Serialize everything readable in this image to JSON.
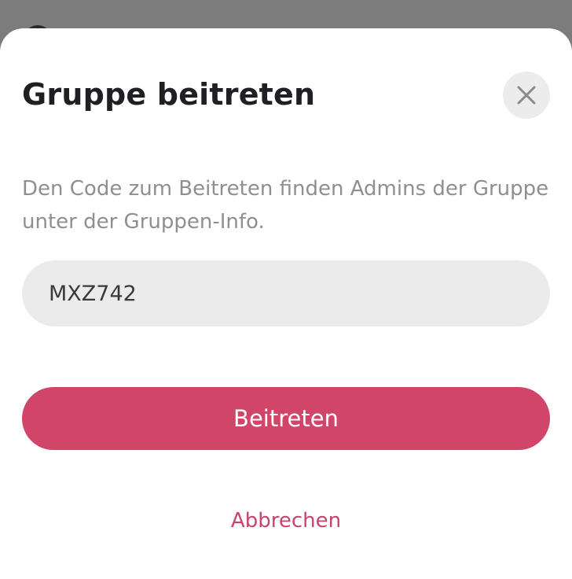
{
  "dialog": {
    "title": "Gruppe beitreten",
    "description": "Den Code zum Beitreten finden Admins der Gruppe unter der Gruppen-Info.",
    "code_input_value": "MXZ742",
    "join_button_label": "Beitreten",
    "cancel_label": "Abbrechen",
    "close_icon": "close-icon"
  },
  "colors": {
    "accent": "#d14668",
    "cancel_text": "#c9446a",
    "title_text": "#1f1f24",
    "description_text": "#8c8f94",
    "input_background": "#ebebeb",
    "close_button_background": "#ececec",
    "overlay": "#7c7c7c"
  }
}
